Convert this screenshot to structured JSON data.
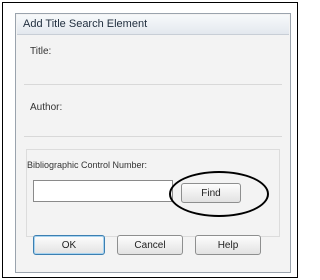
{
  "dialog": {
    "title": "Add Title Search Element",
    "fields": {
      "title_label": "Title:",
      "author_label": "Author:"
    },
    "bcn": {
      "label": "Bibliographic Control Number:",
      "value": "",
      "find_label": "Find"
    },
    "buttons": {
      "ok_label": "OK",
      "cancel_label": "Cancel",
      "help_label": "Help"
    }
  },
  "annotation": {
    "highlight_color": "#000000"
  }
}
